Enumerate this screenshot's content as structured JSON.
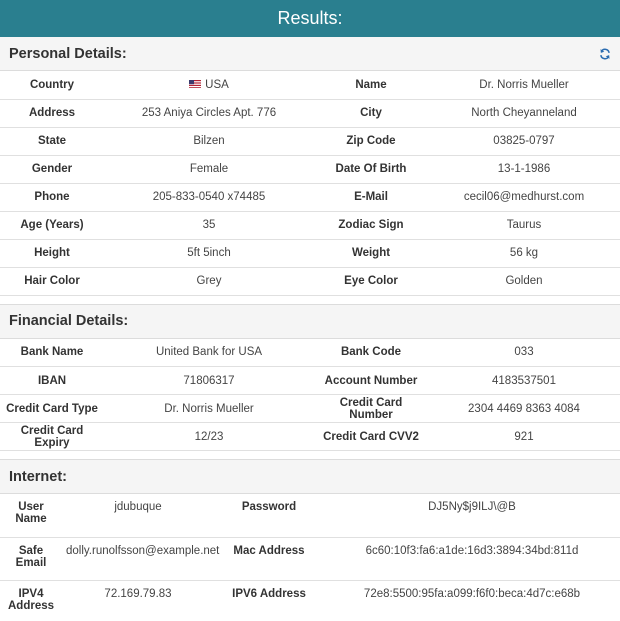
{
  "header": {
    "title": "Results:"
  },
  "personal": {
    "title": "Personal Details:",
    "refresh_icon": "refresh-icon",
    "rows": [
      [
        {
          "label": "Country",
          "value": "USA",
          "flag": true
        },
        {
          "label": "Name",
          "value": "Dr. Norris Mueller"
        }
      ],
      [
        {
          "label": "Address",
          "value": "253 Aniya Circles Apt. 776"
        },
        {
          "label": "City",
          "value": "North Cheyanneland"
        }
      ],
      [
        {
          "label": "State",
          "value": "Bilzen"
        },
        {
          "label": "Zip Code",
          "value": "03825-0797"
        }
      ],
      [
        {
          "label": "Gender",
          "value": "Female"
        },
        {
          "label": "Date Of Birth",
          "value": "13-1-1986"
        }
      ],
      [
        {
          "label": "Phone",
          "value": "205-833-0540 x74485"
        },
        {
          "label": "E-Mail",
          "value": "cecil06@medhurst.com"
        }
      ],
      [
        {
          "label": "Age (Years)",
          "value": "35"
        },
        {
          "label": "Zodiac Sign",
          "value": "Taurus"
        }
      ],
      [
        {
          "label": "Height",
          "value": "5ft 5inch"
        },
        {
          "label": "Weight",
          "value": "56 kg"
        }
      ],
      [
        {
          "label": "Hair Color",
          "value": "Grey"
        },
        {
          "label": "Eye Color",
          "value": "Golden"
        }
      ]
    ]
  },
  "financial": {
    "title": "Financial Details:",
    "rows": [
      [
        {
          "label": "Bank Name",
          "value": "United Bank for USA"
        },
        {
          "label": "Bank Code",
          "value": "033"
        }
      ],
      [
        {
          "label": "IBAN",
          "value": "71806317"
        },
        {
          "label": "Account Number",
          "value": "4183537501"
        }
      ],
      [
        {
          "label": "Credit Card Type",
          "value": "Dr. Norris Mueller"
        },
        {
          "label": "Credit Card Number",
          "value": "2304 4469 8363 4084"
        }
      ],
      [
        {
          "label": "Credit Card Expiry",
          "value": "12/23"
        },
        {
          "label": "Credit Card CVV2",
          "value": "921"
        }
      ]
    ]
  },
  "internet": {
    "title": "Internet:",
    "rows": [
      [
        {
          "label": "User Name",
          "value": "jdubuque"
        },
        {
          "label": "Password",
          "value": "DJ5Ny$j9ILJ\\@B"
        }
      ],
      [
        {
          "label": "Safe Email",
          "value": "dolly.runolfsson@example.net"
        },
        {
          "label": "Mac Address",
          "value": "6c60:10f3:fa6:a1de:16d3:3894:34bd:811d"
        }
      ],
      [
        {
          "label": "IPV4 Address",
          "value": "72.169.79.83"
        },
        {
          "label": "IPV6 Address",
          "value": "72e8:5500:95fa:a099:f6f0:beca:4d7c:e68b"
        }
      ]
    ]
  },
  "colors": {
    "header_bg": "#2a7f8f",
    "refresh_icon": "#2b6cb0"
  }
}
